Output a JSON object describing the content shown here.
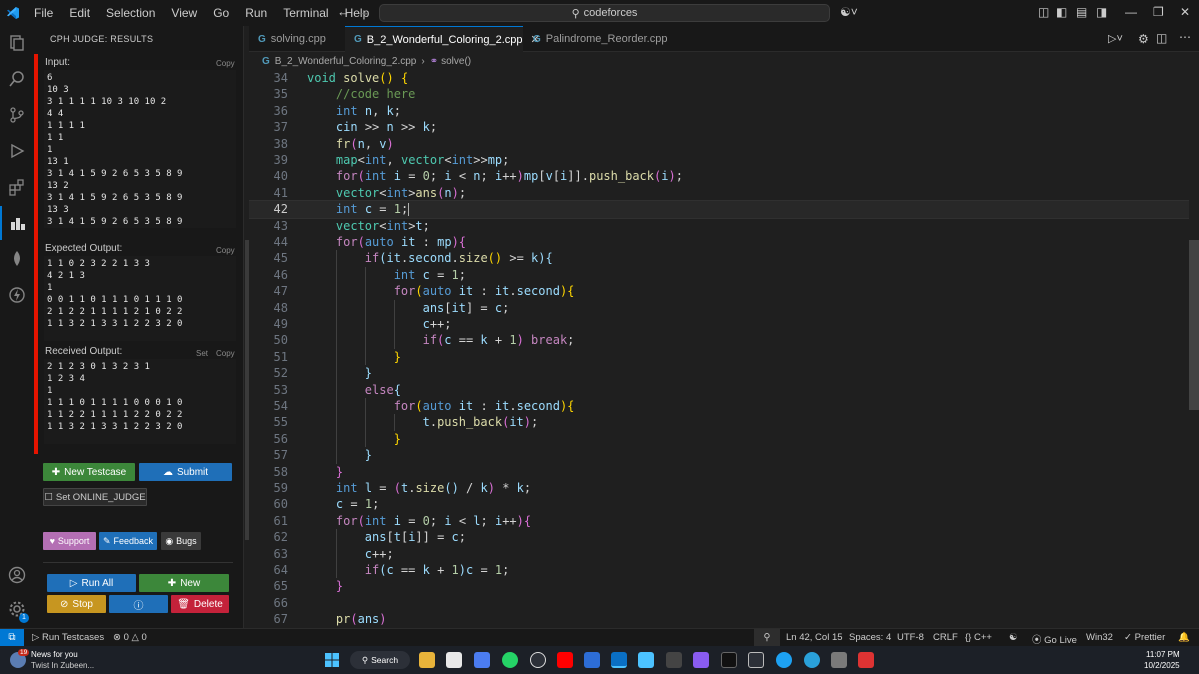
{
  "titlebar": {
    "menus": [
      "File",
      "Edit",
      "Selection",
      "View",
      "Go",
      "Run",
      "Terminal",
      "Help"
    ],
    "search": "codeforces"
  },
  "sidebar": {
    "title": "CPH JUDGE: RESULTS",
    "input_label": "Input:",
    "input": "6\n10 3\n3 1 1 1 1 10 3 10 10 2\n4 4\n1 1 1 1\n1 1\n1\n13 1\n3 1 4 1 5 9 2 6 5 3 5 8 9\n13 2\n3 1 4 1 5 9 2 6 5 3 5 8 9\n13 3\n3 1 4 1 5 9 2 6 5 3 5 8 9",
    "copy": "Copy",
    "expected_label": "Expected Output:",
    "expected": "1 1 0 2 3 2 2 1 3 3\n4 2 1 3\n1\n0 0 1 1 0 1 1 1 0 1 1 1 0\n2 1 2 2 1 1 1 1 2 1 0 2 2\n1 1 3 2 1 3 3 1 2 2 3 2 0",
    "received_label": "Received Output:",
    "set": "Set",
    "received": "2 1 2 3 0 1 3 2 3 1\n1 2 3 4\n1\n1 1 1 0 1 1 1 1 0 0 0 1 0\n1 1 2 2 1 1 1 1 2 2 0 2 2\n1 1 3 2 1 3 3 1 2 2 3 2 0",
    "new_testcase": "New Testcase",
    "submit": "Submit",
    "online_judge": "Set ONLINE_JUDGE",
    "support": "Support",
    "feedback": "Feedback",
    "bugs": "Bugs",
    "run_all": "Run All",
    "new": "New",
    "stop": "Stop",
    "delete": "Delete"
  },
  "tabs": [
    "solving.cpp",
    "B_2_Wonderful_Coloring_2.cpp",
    "Palindrome_Reorder.cpp"
  ],
  "breadcrumb": {
    "file": "B_2_Wonderful_Coloring_2.cpp",
    "symbol": "solve()"
  },
  "editor": {
    "current_line": 42,
    "lines": [
      {
        "n": "34",
        "c": "<span class='t'>void</span> <span class='f'>solve</span><span class='p'>()</span> <span class='p'>{</span>"
      },
      {
        "n": "35",
        "c": "    <span class='c'>//code here</span>"
      },
      {
        "n": "36",
        "c": "    <span class='k'>int</span> <span class='v'>n</span>, <span class='v'>k</span>;"
      },
      {
        "n": "37",
        "c": "    <span class='v'>cin</span> &gt;&gt; <span class='v'>n</span> &gt;&gt; <span class='v'>k</span>;"
      },
      {
        "n": "38",
        "c": "    <span class='f'>fr</span><span class='pp'>(</span><span class='v'>n</span>, <span class='v'>v</span><span class='pp'>)</span>"
      },
      {
        "n": "39",
        "c": "    <span class='t'>map</span>&lt;<span class='k'>int</span>, <span class='t'>vector</span>&lt;<span class='k'>int</span>&gt;&gt;<span class='v'>mp</span>;"
      },
      {
        "n": "40",
        "c": "    <span class='kw'>for</span><span class='pp'>(</span><span class='k'>int</span> <span class='v'>i</span> = <span class='n'>0</span>; <span class='v'>i</span> &lt; <span class='v'>n</span>; <span class='v'>i</span>++<span class='pp'>)</span><span class='v'>mp</span>[<span class='v'>v</span>[<span class='v'>i</span>]].<span class='f'>push_back</span><span class='pp'>(</span><span class='v'>i</span><span class='pp'>)</span>;"
      },
      {
        "n": "41",
        "c": "    <span class='t'>vector</span>&lt;<span class='k'>int</span>&gt;<span class='f'>ans</span><span class='pp'>(</span><span class='v'>n</span><span class='pp'>)</span>;"
      },
      {
        "n": "42",
        "c": "    <span class='k'>int</span> <span class='v'>c</span> = <span class='n'>1</span>;"
      },
      {
        "n": "43",
        "c": "    <span class='t'>vector</span>&lt;<span class='k'>int</span>&gt;<span class='v'>t</span>;"
      },
      {
        "n": "44",
        "c": "    <span class='kw'>for</span><span class='pp'>(</span><span class='k'>auto</span> <span class='v'>it</span> : <span class='v'>mp</span><span class='pp'>){</span>"
      },
      {
        "n": "45",
        "c": "        <span class='kw'>if</span><span class='v'>(it</span>.<span class='v'>second</span>.<span class='f'>size</span><span class='p'>()</span> &gt;= <span class='v'>k</span><span class='v'>)</span><span class='v'>{</span>"
      },
      {
        "n": "46",
        "c": "            <span class='k'>int</span> <span class='v'>c</span> = <span class='n'>1</span>;"
      },
      {
        "n": "47",
        "c": "            <span class='kw'>for</span><span class='p'>(</span><span class='k'>auto</span> <span class='v'>it</span> : <span class='v'>it</span>.<span class='v'>second</span><span class='p'>){</span>"
      },
      {
        "n": "48",
        "c": "                <span class='v'>ans</span>[<span class='v'>it</span>] = <span class='v'>c</span>;"
      },
      {
        "n": "49",
        "c": "                <span class='v'>c</span>++;"
      },
      {
        "n": "50",
        "c": "                <span class='kw'>if</span><span class='pp'>(</span><span class='v'>c</span> == <span class='v'>k</span> + <span class='n'>1</span><span class='pp'>)</span> <span class='kw'>break</span>;"
      },
      {
        "n": "51",
        "c": "            <span class='p'>}</span>"
      },
      {
        "n": "52",
        "c": "        <span class='v'>}</span>"
      },
      {
        "n": "53",
        "c": "        <span class='kw'>else</span><span class='v'>{</span>"
      },
      {
        "n": "54",
        "c": "            <span class='kw'>for</span><span class='p'>(</span><span class='k'>auto</span> <span class='v'>it</span> : <span class='v'>it</span>.<span class='v'>second</span><span class='p'>){</span>"
      },
      {
        "n": "55",
        "c": "                <span class='v'>t</span>.<span class='f'>push_back</span><span class='pp'>(</span><span class='v'>it</span><span class='pp'>)</span>;"
      },
      {
        "n": "56",
        "c": "            <span class='p'>}</span>"
      },
      {
        "n": "57",
        "c": "        <span class='v'>}</span>"
      },
      {
        "n": "58",
        "c": "    <span class='pp'>}</span>"
      },
      {
        "n": "59",
        "c": "    <span class='k'>int</span> <span class='v'>l</span> = <span class='pp'>(</span><span class='v'>t</span>.<span class='f'>size</span><span class='v'>()</span> / <span class='v'>k</span><span class='pp'>)</span> * <span class='v'>k</span>;"
      },
      {
        "n": "60",
        "c": "    <span class='v'>c</span> = <span class='n'>1</span>;"
      },
      {
        "n": "61",
        "c": "    <span class='kw'>for</span><span class='pp'>(</span><span class='k'>int</span> <span class='v'>i</span> = <span class='n'>0</span>; <span class='v'>i</span> &lt; <span class='v'>l</span>; <span class='v'>i</span>++<span class='pp'>){</span>"
      },
      {
        "n": "62",
        "c": "        <span class='v'>ans</span>[<span class='v'>t</span>[<span class='v'>i</span>]] = <span class='v'>c</span>;"
      },
      {
        "n": "63",
        "c": "        <span class='v'>c</span>++;"
      },
      {
        "n": "64",
        "c": "        <span class='kw'>if</span><span class='v'>(c</span> == <span class='v'>k</span> + <span class='n'>1</span><span class='v'>)c</span> = <span class='n'>1</span>;"
      },
      {
        "n": "65",
        "c": "    <span class='pp'>}</span>"
      },
      {
        "n": "66",
        "c": ""
      },
      {
        "n": "67",
        "c": "    <span class='f'>pr</span><span class='pp'>(</span><span class='v'>ans</span><span class='pp'>)</span>"
      }
    ]
  },
  "statusbar": {
    "run_testcases": "Run Testcases",
    "errors": "0",
    "warnings": "0",
    "position": "Ln 42, Col 15",
    "spaces": "Spaces: 4",
    "encoding": "UTF-8",
    "eol": "CRLF",
    "language": "C++",
    "go_live": "Go Live",
    "platform": "Win32",
    "prettier": "Prettier"
  },
  "taskbar": {
    "news_title": "News for you",
    "news_sub": "Twist In Zubeen...",
    "badge": "19",
    "search": "Search",
    "time": "11:07 PM",
    "date": "10/2/2025"
  },
  "colors": {
    "accent": "#0078d4",
    "red": "#e51400",
    "green": "#3c873a",
    "blue": "#1f6fb8"
  }
}
